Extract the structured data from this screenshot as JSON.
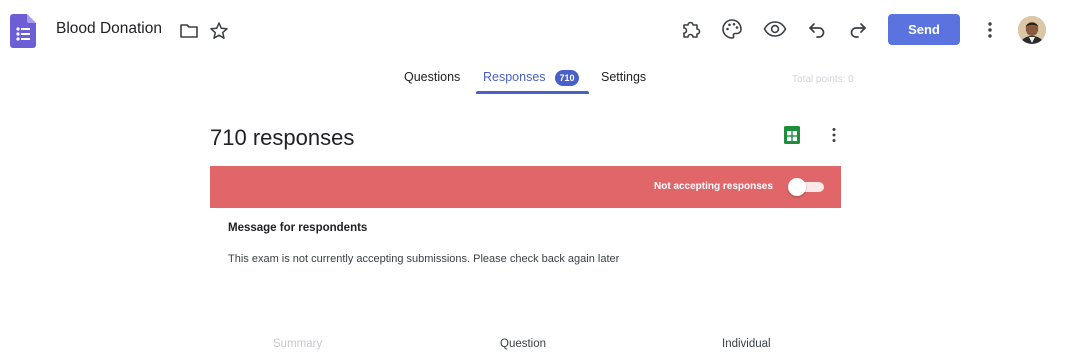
{
  "header": {
    "title": "Blood Donation",
    "send_label": "Send",
    "icons": [
      "forms-logo-icon",
      "folder-icon",
      "star-icon",
      "puzzle-icon",
      "palette-icon",
      "eye-icon",
      "undo-icon",
      "redo-icon",
      "more-vert-icon",
      "avatar"
    ]
  },
  "tabs": {
    "questions": "Questions",
    "responses": "Responses",
    "responses_count": "710",
    "settings": "Settings",
    "total_points": "Total points: 0"
  },
  "responses": {
    "title": "710 responses",
    "banner_text": "Not accepting responses",
    "accepting": false,
    "message_label": "Message for respondents",
    "message_body": "This exam is not currently accepting submissions. Please check back again later"
  },
  "subtabs": {
    "summary": "Summary",
    "question": "Question",
    "individual": "Individual"
  },
  "colors": {
    "accent": "#4a5fc8",
    "send_button": "#5b73df",
    "banner": "#e0666a",
    "sheets_green": "#1e8e3e",
    "forms_purple": "#6c5fd6"
  }
}
